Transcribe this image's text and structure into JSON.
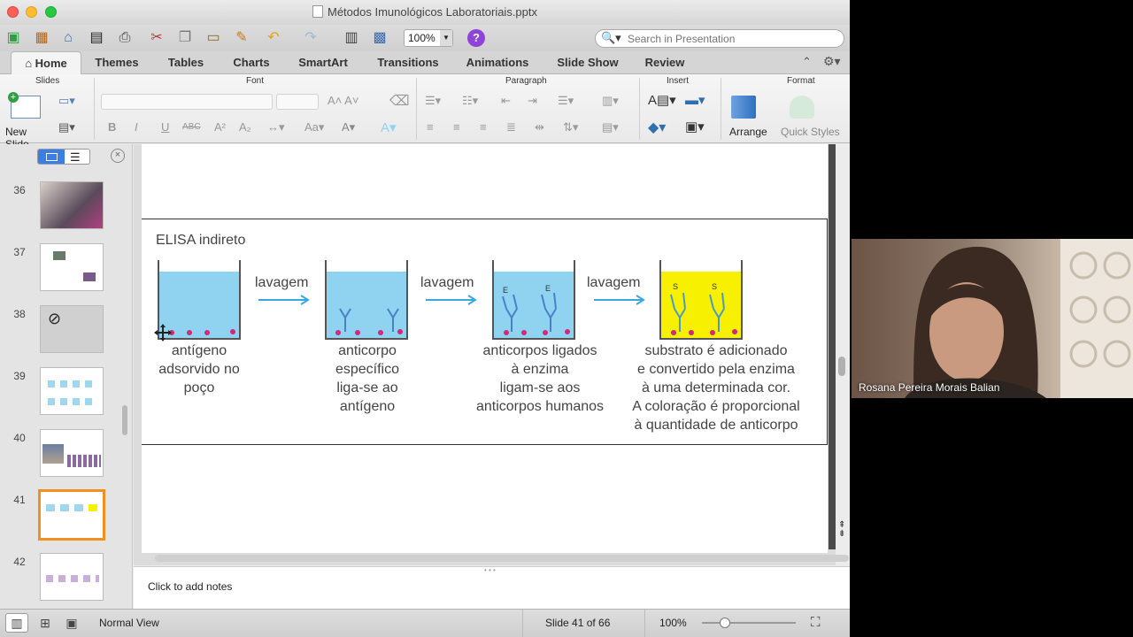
{
  "window": {
    "title": "Métodos Imunológicos Laboratoriais.pptx"
  },
  "toolbar": {
    "zoom": "100%",
    "search_placeholder": "Search in Presentation"
  },
  "tabs": [
    "Home",
    "Themes",
    "Tables",
    "Charts",
    "SmartArt",
    "Transitions",
    "Animations",
    "Slide Show",
    "Review"
  ],
  "ribbon": {
    "groups": [
      "Slides",
      "Font",
      "Paragraph",
      "Insert",
      "Format"
    ],
    "new_slide": "New Slide",
    "arrange": "Arrange",
    "quick_styles": "Quick Styles"
  },
  "sidebar": {
    "slides": [
      {
        "num": "36"
      },
      {
        "num": "37"
      },
      {
        "num": "38"
      },
      {
        "num": "39"
      },
      {
        "num": "40"
      },
      {
        "num": "41"
      },
      {
        "num": "42"
      }
    ]
  },
  "slide": {
    "title": "ELISA indireto",
    "wash": "lavagem",
    "steps": [
      "antígeno\nadsorvido no\npoço",
      "anticorpo\nespecífico\nliga-se ao\nantígeno",
      "anticorpos ligados\nà enzima\nligam-se aos\nanticorpos humanos",
      "substrato é adicionado\ne convertido pela enzima\nà uma determinada cor.\nA coloração é proporcional\nà quantidade de anticorpo"
    ]
  },
  "notes": {
    "placeholder": "Click to add notes"
  },
  "status": {
    "view": "Normal View",
    "slide": "Slide 41 of 66",
    "zoom": "100%"
  },
  "video": {
    "participant": "Rosana Pereira Morais Balian"
  },
  "colors": {
    "accent": "#3a7ee6",
    "selection": "#f09021",
    "well_blue": "#8fd3f0",
    "well_yellow": "#f7f000"
  }
}
